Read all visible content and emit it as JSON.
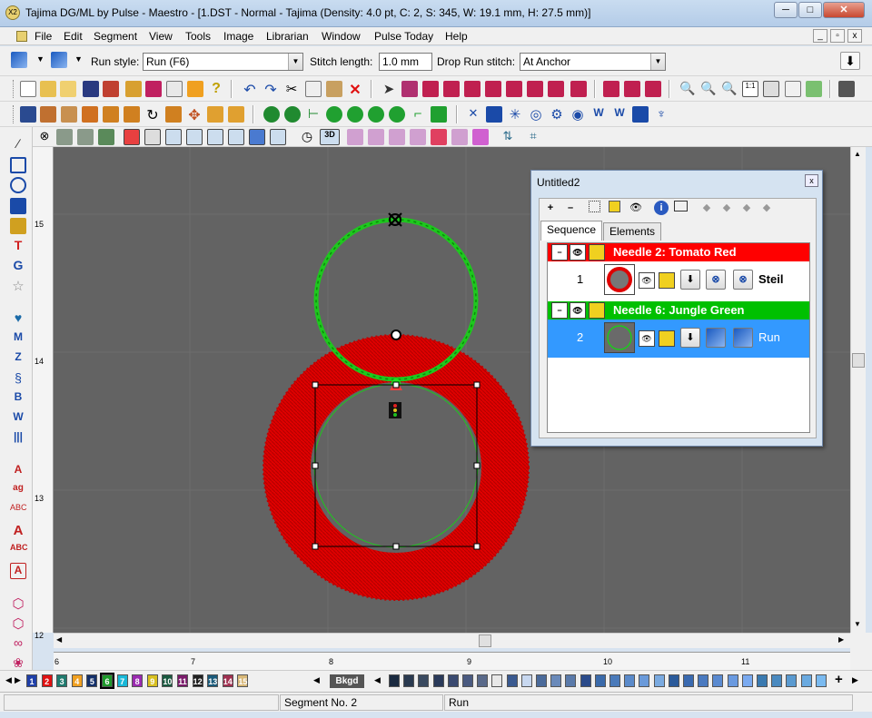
{
  "window": {
    "title": "Tajima DG/ML by Pulse - Maestro - [1.DST - Normal - Tajima (Density: 4.0 pt, C: 2, S: 345, W: 19.1 mm, H: 27.5 mm)]",
    "minimize": "─",
    "maximize": "□",
    "close": "✕"
  },
  "menu": {
    "items": [
      "File",
      "Edit",
      "Segment",
      "View",
      "Tools",
      "Image",
      "Librarian",
      "Window",
      "Pulse Today",
      "Help"
    ],
    "mdi_min": "_",
    "mdi_restore": "▫",
    "mdi_close": "x"
  },
  "propbar": {
    "run_style_label": "Run style:",
    "run_style_value": "Run (F6)",
    "stitch_length_label": "Stitch length:",
    "stitch_length_value": "1.0 mm",
    "drop_run_label": "Drop Run stitch:",
    "drop_run_value": "At Anchor"
  },
  "rulers": {
    "vertical": [
      "15",
      "14",
      "13",
      "12"
    ],
    "horizontal": [
      "6",
      "7",
      "8",
      "9",
      "10",
      "11"
    ]
  },
  "palette": {
    "needles": [
      {
        "n": "1",
        "color": "#1f3fa8"
      },
      {
        "n": "2",
        "color": "#e01010"
      },
      {
        "n": "3",
        "color": "#1f7a6e"
      },
      {
        "n": "4",
        "color": "#f0a020"
      },
      {
        "n": "5",
        "color": "#14306a"
      },
      {
        "n": "6",
        "color": "#1e9a2a"
      },
      {
        "n": "7",
        "color": "#18b8d8"
      },
      {
        "n": "8",
        "color": "#9a2ab0"
      },
      {
        "n": "9",
        "color": "#d8c020"
      },
      {
        "n": "10",
        "color": "#1a5a40"
      },
      {
        "n": "11",
        "color": "#7a1a6a"
      },
      {
        "n": "12",
        "color": "#202020"
      },
      {
        "n": "13",
        "color": "#1a5a7a"
      },
      {
        "n": "14",
        "color": "#a03050"
      },
      {
        "n": "15",
        "color": "#d8b878"
      }
    ],
    "bkgd": "Bkgd"
  },
  "status": {
    "segment": "Segment No. 2",
    "type": "Run"
  },
  "panel": {
    "title": "Untitled2",
    "close": "x",
    "tabs": [
      "Sequence",
      "Elements"
    ],
    "needles": [
      {
        "header": "Needle 2: Tomato Red",
        "color": "#ff0000",
        "seg_no": "1",
        "seg_name": "Steil"
      },
      {
        "header": "Needle 6: Jungle Green",
        "color": "#00c000",
        "seg_no": "2",
        "seg_name": "Run"
      }
    ]
  },
  "colors": {
    "canvas": "#636363",
    "tomato_red": "#ff0000",
    "jungle_green": "#1ec81e",
    "selection": "#3399ff"
  }
}
